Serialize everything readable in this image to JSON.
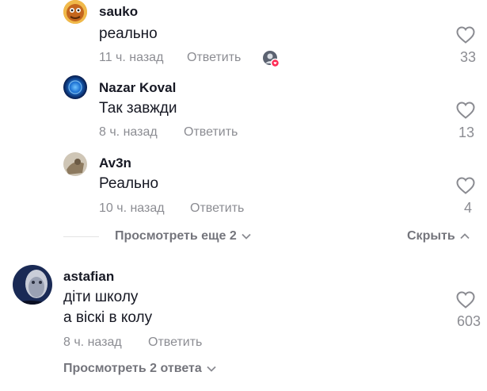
{
  "replies": [
    {
      "username": "sauko",
      "text": "реально",
      "time": "11 ч. назад",
      "reply_label": "Ответить",
      "likes": "33",
      "creator_liked": true
    },
    {
      "username": "Nazar Koval",
      "text": "Так завжди",
      "time": "8 ч. назад",
      "reply_label": "Ответить",
      "likes": "13"
    },
    {
      "username": "Av3n",
      "text": "Реально",
      "time": "10 ч. назад",
      "reply_label": "Ответить",
      "likes": "4"
    }
  ],
  "reply_controls": {
    "view_more": "Просмотреть еще 2",
    "hide": "Скрыть"
  },
  "comment": {
    "username": "astafian",
    "text_line1": "діти школу",
    "text_line2": "а віскі в колу",
    "time": "8 ч. назад",
    "reply_label": "Ответить",
    "likes": "603",
    "view_replies": "Просмотреть 2 ответа"
  },
  "colors": {
    "text_primary": "#161823",
    "text_secondary": "#8a8b91",
    "like_badge": "#fe2c55"
  }
}
